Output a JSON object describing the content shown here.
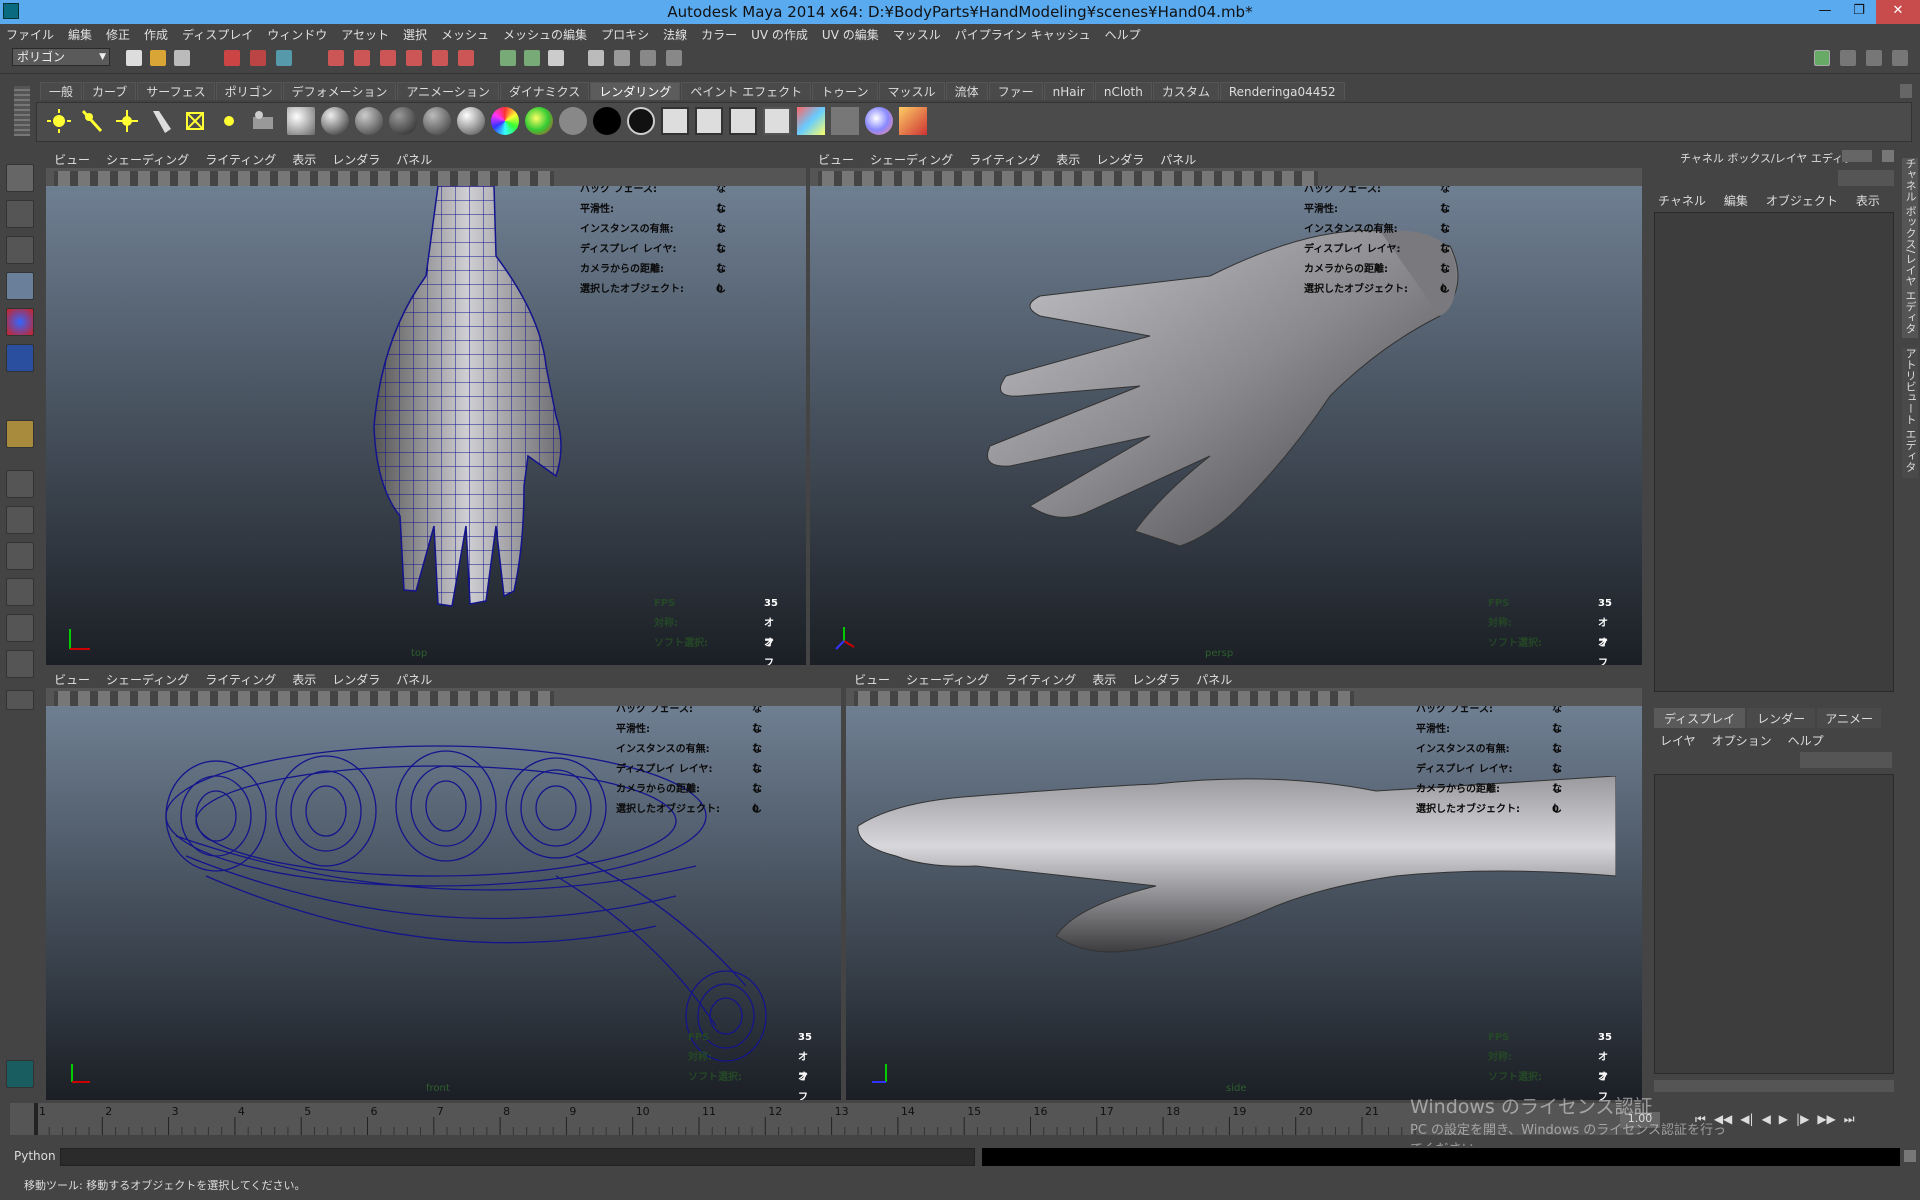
{
  "window": {
    "title": "Autodesk Maya 2014 x64: D:¥BodyParts¥HandModeling¥scenes¥Hand04.mb*"
  },
  "menubar": [
    "ファイル",
    "編集",
    "修正",
    "作成",
    "ディスプレイ",
    "ウィンドウ",
    "アセット",
    "選択",
    "メッシュ",
    "メッシュの編集",
    "プロキシ",
    "法線",
    "カラー",
    "UV の作成",
    "UV の編集",
    "マッスル",
    "パイプライン キャッシュ",
    "ヘルプ"
  ],
  "mode_selector": "ポリゴン",
  "shelf_tabs": [
    "一般",
    "カーブ",
    "サーフェス",
    "ポリゴン",
    "デフォメーション",
    "アニメーション",
    "ダイナミクス",
    "レンダリング",
    "ペイント エフェクト",
    "トゥーン",
    "マッスル",
    "流体",
    "ファー",
    "nHair",
    "nCloth",
    "カスタム",
    "Renderinga04452"
  ],
  "shelf_active_tab": "レンダリング",
  "panel_menu": [
    "ビュー",
    "シェーディング",
    "ライティング",
    "表示",
    "レンダラ",
    "パネル"
  ],
  "hud": {
    "labels": [
      "バック フェース:",
      "平滑性:",
      "インスタンスの有無:",
      "ディスプレイ レイヤ:",
      "カメラからの距離:",
      "選択したオブジェクト:"
    ],
    "values": [
      "なし",
      "なし",
      "なし",
      "なし",
      "なし",
      "0"
    ],
    "bottom_labels": [
      "FPS",
      "対称:",
      "ソフト選択:"
    ],
    "bottom_values": [
      "35",
      "オフ",
      "オフ"
    ]
  },
  "viewports": [
    {
      "camera": "top"
    },
    {
      "camera": "persp"
    },
    {
      "camera": "front"
    },
    {
      "camera": "side"
    }
  ],
  "channel_box": {
    "title": "チャネル ボックス/レイヤ エディタ",
    "menu": [
      "チャネル",
      "編集",
      "オブジェクト",
      "表示"
    ]
  },
  "layer_editor": {
    "tabs": [
      "ディスプレイ",
      "レンダー",
      "アニメー"
    ],
    "menu": [
      "レイヤ",
      "オプション",
      "ヘルプ"
    ]
  },
  "side_tabs": [
    "チャネル ボックス/レイヤ エディタ",
    "アトリビュート エディタ"
  ],
  "timeline": {
    "ticks": [
      "1",
      "2",
      "3",
      "4",
      "5",
      "6",
      "7",
      "8",
      "9",
      "10",
      "11",
      "12",
      "13",
      "14",
      "15",
      "16",
      "17",
      "18",
      "19",
      "20",
      "21"
    ],
    "current_frame": "1.00"
  },
  "command_line": {
    "language": "Python"
  },
  "help_line": "移動ツール: 移動するオブジェクトを選択してください。",
  "watermark": {
    "title": "Windows のライセンス認証",
    "body": "PC の設定を開き、Windows のライセンス認証を行ってください。"
  },
  "colors": {
    "title_bar": "#5aaaf0",
    "ui_bg": "#444444",
    "wire": "#14148c",
    "hud_green": "#254826"
  }
}
